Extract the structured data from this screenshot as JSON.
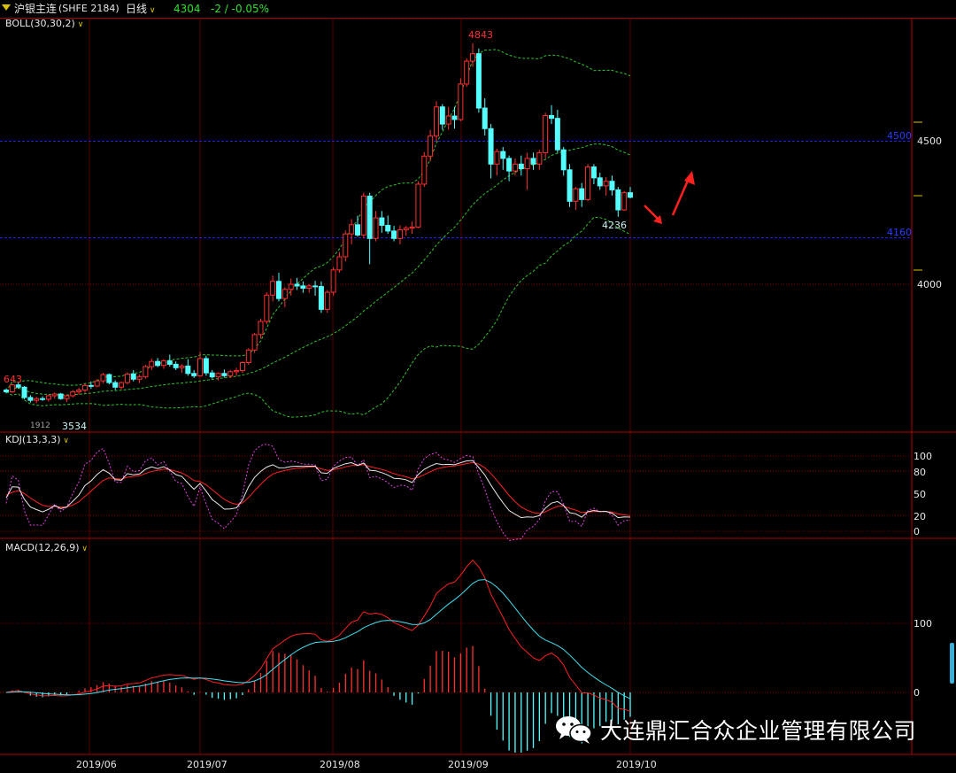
{
  "header": {
    "symbol": "沪银主连",
    "exchange_code": "(SHFE 2184)",
    "period": "日线",
    "last_price": "4304",
    "change": "-2 / -0.05%"
  },
  "boll": {
    "label": "BOLL(30,30,2)",
    "high_marker": "4843",
    "low_marker": "4236",
    "left_marker": "643",
    "bottom_marker": "3534",
    "left_bottom_text": "1912"
  },
  "price_axis": {
    "ticks": [
      "4500",
      "4000"
    ],
    "line_labels": [
      "4500",
      "4160"
    ]
  },
  "kdj": {
    "label": "KDJ(13,3,3)",
    "ticks": [
      "100",
      "80",
      "50",
      "20",
      "0"
    ]
  },
  "macd": {
    "label": "MACD(12,26,9)",
    "ticks": [
      "100",
      "0"
    ]
  },
  "time_axis": [
    "2019/06",
    "2019/07",
    "2019/08",
    "2019/09",
    "2019/10"
  ],
  "watermark": {
    "company": "大连鼎汇合众企业管理有限公司"
  },
  "colors": {
    "up": "#ff3030",
    "down": "#54ffff",
    "bg": "#000000",
    "grid": "#5a0000",
    "axis": "#b00000",
    "k_line": "#e8e8e8",
    "d_line": "#ff2020",
    "j_line": "#e040e0",
    "dif": "#ff2020",
    "dea": "#40e0f0",
    "boll_band": "#30c030",
    "arrow": "#ff2020"
  },
  "chart_data": {
    "type": "candlestick",
    "title": "沪银主连 日线",
    "candles": [
      [
        3630,
        3636,
        3618,
        3624
      ],
      [
        3624,
        3652,
        3620,
        3648
      ],
      [
        3648,
        3656,
        3634,
        3640
      ],
      [
        3640,
        3644,
        3598,
        3604
      ],
      [
        3604,
        3612,
        3586,
        3594
      ],
      [
        3594,
        3606,
        3584,
        3600
      ],
      [
        3600,
        3608,
        3592,
        3598
      ],
      [
        3598,
        3614,
        3590,
        3610
      ],
      [
        3610,
        3622,
        3600,
        3616
      ],
      [
        3616,
        3620,
        3596,
        3600
      ],
      [
        3600,
        3614,
        3588,
        3610
      ],
      [
        3610,
        3630,
        3604,
        3624
      ],
      [
        3624,
        3638,
        3614,
        3630
      ],
      [
        3630,
        3652,
        3620,
        3646
      ],
      [
        3646,
        3660,
        3634,
        3644
      ],
      [
        3644,
        3668,
        3640,
        3662
      ],
      [
        3662,
        3690,
        3654,
        3684
      ],
      [
        3684,
        3688,
        3650,
        3656
      ],
      [
        3656,
        3664,
        3630,
        3640
      ],
      [
        3640,
        3660,
        3632,
        3656
      ],
      [
        3656,
        3692,
        3650,
        3686
      ],
      [
        3686,
        3700,
        3660,
        3668
      ],
      [
        3668,
        3684,
        3654,
        3676
      ],
      [
        3676,
        3718,
        3670,
        3712
      ],
      [
        3712,
        3740,
        3700,
        3730
      ],
      [
        3730,
        3742,
        3710,
        3716
      ],
      [
        3716,
        3738,
        3704,
        3732
      ],
      [
        3732,
        3754,
        3712,
        3720
      ],
      [
        3720,
        3730,
        3700,
        3708
      ],
      [
        3708,
        3720,
        3690,
        3714
      ],
      [
        3714,
        3738,
        3680,
        3688
      ],
      [
        3688,
        3700,
        3672,
        3680
      ],
      [
        3680,
        3764,
        3676,
        3740
      ],
      [
        3740,
        3750,
        3680,
        3690
      ],
      [
        3690,
        3700,
        3670,
        3676
      ],
      [
        3676,
        3692,
        3664,
        3688
      ],
      [
        3688,
        3702,
        3674,
        3680
      ],
      [
        3680,
        3700,
        3672,
        3694
      ],
      [
        3694,
        3708,
        3680,
        3698
      ],
      [
        3698,
        3730,
        3690,
        3726
      ],
      [
        3726,
        3776,
        3718,
        3770
      ],
      [
        3770,
        3830,
        3760,
        3824
      ],
      [
        3824,
        3880,
        3810,
        3870
      ],
      [
        3870,
        3972,
        3860,
        3962
      ],
      [
        3962,
        4030,
        3940,
        4010
      ],
      [
        4010,
        4040,
        3940,
        3950
      ],
      [
        3950,
        3990,
        3920,
        3982
      ],
      [
        3982,
        4020,
        3960,
        4000
      ],
      [
        4000,
        4022,
        3980,
        3994
      ],
      [
        3994,
        4010,
        3970,
        3986
      ],
      [
        3986,
        4000,
        3970,
        3994
      ],
      [
        3994,
        4012,
        3960,
        3992
      ],
      [
        3992,
        4010,
        3900,
        3912
      ],
      [
        3912,
        3980,
        3900,
        3972
      ],
      [
        3972,
        4060,
        3960,
        4050
      ],
      [
        4050,
        4112,
        4040,
        4096
      ],
      [
        4096,
        4188,
        4080,
        4176
      ],
      [
        4176,
        4228,
        4140,
        4208
      ],
      [
        4208,
        4240,
        4166,
        4172
      ],
      [
        4172,
        4320,
        4160,
        4308
      ],
      [
        4308,
        4320,
        4070,
        4160
      ],
      [
        4160,
        4256,
        4150,
        4232
      ],
      [
        4232,
        4256,
        4180,
        4206
      ],
      [
        4206,
        4240,
        4176,
        4186
      ],
      [
        4186,
        4204,
        4150,
        4160
      ],
      [
        4160,
        4206,
        4140,
        4190
      ],
      [
        4190,
        4204,
        4170,
        4196
      ],
      [
        4196,
        4220,
        4176,
        4200
      ],
      [
        4200,
        4360,
        4196,
        4350
      ],
      [
        4350,
        4462,
        4340,
        4448
      ],
      [
        4448,
        4540,
        4430,
        4518
      ],
      [
        4518,
        4640,
        4500,
        4620
      ],
      [
        4620,
        4630,
        4540,
        4560
      ],
      [
        4560,
        4620,
        4540,
        4588
      ],
      [
        4588,
        4620,
        4544,
        4576
      ],
      [
        4576,
        4720,
        4570,
        4700
      ],
      [
        4700,
        4790,
        4690,
        4780
      ],
      [
        4780,
        4843,
        4760,
        4806
      ],
      [
        4806,
        4824,
        4600,
        4616
      ],
      [
        4616,
        4650,
        4520,
        4544
      ],
      [
        4544,
        4560,
        4370,
        4420
      ],
      [
        4420,
        4474,
        4380,
        4464
      ],
      [
        4464,
        4480,
        4400,
        4440
      ],
      [
        4440,
        4450,
        4360,
        4396
      ],
      [
        4396,
        4440,
        4380,
        4420
      ],
      [
        4420,
        4450,
        4380,
        4404
      ],
      [
        4404,
        4460,
        4330,
        4440
      ],
      [
        4440,
        4460,
        4400,
        4420
      ],
      [
        4420,
        4470,
        4400,
        4460
      ],
      [
        4460,
        4600,
        4440,
        4590
      ],
      [
        4590,
        4626,
        4560,
        4580
      ],
      [
        4580,
        4610,
        4460,
        4470
      ],
      [
        4470,
        4480,
        4380,
        4400
      ],
      [
        4400,
        4420,
        4270,
        4290
      ],
      [
        4290,
        4340,
        4260,
        4334
      ],
      [
        4334,
        4354,
        4270,
        4296
      ],
      [
        4296,
        4420,
        4290,
        4410
      ],
      [
        4410,
        4420,
        4350,
        4372
      ],
      [
        4372,
        4390,
        4330,
        4344
      ],
      [
        4344,
        4374,
        4310,
        4360
      ],
      [
        4360,
        4380,
        4310,
        4330
      ],
      [
        4330,
        4340,
        4236,
        4260
      ],
      [
        4260,
        4326,
        4256,
        4320
      ],
      [
        4320,
        4340,
        4300,
        4304
      ]
    ]
  }
}
